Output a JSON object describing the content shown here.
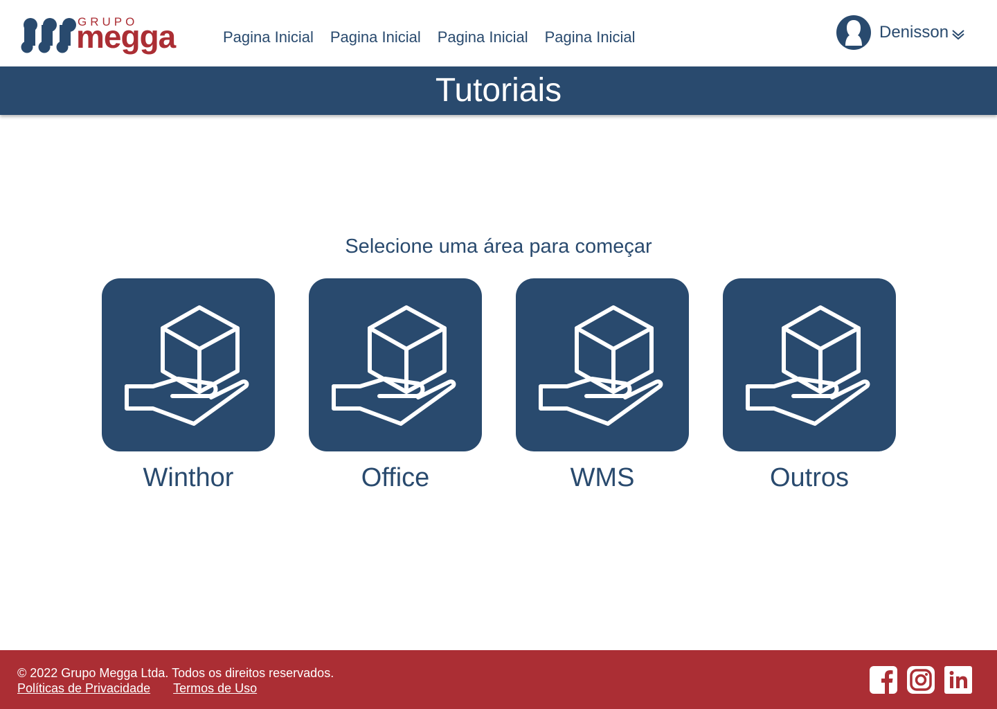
{
  "brand": {
    "name_small": "GRUPO",
    "name_large": "megga",
    "colors": {
      "primary": "#294a6e",
      "accent": "#ab2e34"
    }
  },
  "nav": {
    "items": [
      {
        "label": "Pagina Inicial"
      },
      {
        "label": "Pagina Inicial"
      },
      {
        "label": "Pagina Inicial"
      },
      {
        "label": "Pagina Inicial"
      }
    ]
  },
  "user": {
    "name": "Denisson",
    "avatar_icon": "user-avatar-icon",
    "menu_icon": "chevron-double-down-icon"
  },
  "page": {
    "title": "Tutoriais",
    "subtitle": "Selecione uma área para começar"
  },
  "areas": [
    {
      "label": "Winthor",
      "icon": "hand-holding-box-icon"
    },
    {
      "label": "Office",
      "icon": "hand-holding-box-icon"
    },
    {
      "label": "WMS",
      "icon": "hand-holding-box-icon"
    },
    {
      "label": "Outros",
      "icon": "hand-holding-box-icon"
    }
  ],
  "footer": {
    "copyright": "© 2022 Grupo Megga Ltda. Todos os direitos reservados.",
    "privacy_label": "Políticas de Privacidade",
    "terms_label": "Termos de Uso",
    "social": [
      "facebook-icon",
      "instagram-icon",
      "linkedin-icon"
    ]
  }
}
